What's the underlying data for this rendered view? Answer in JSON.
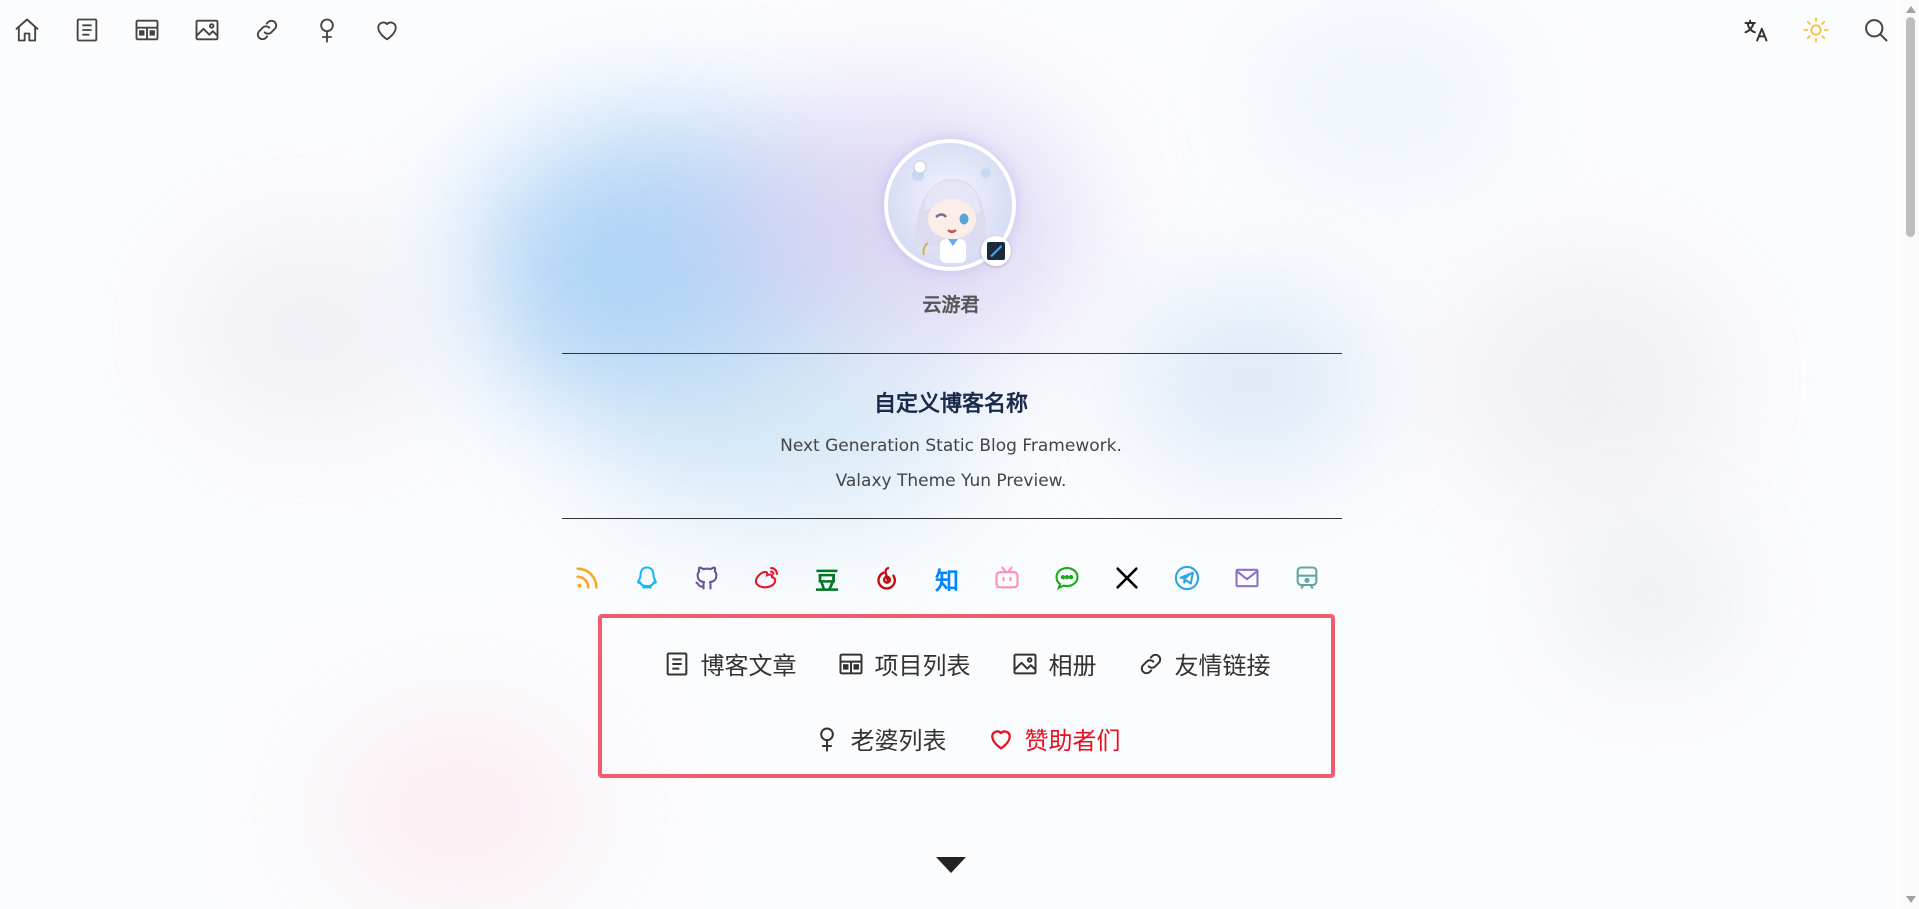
{
  "top_nav": {
    "left_icons": [
      "home-icon",
      "articles-icon",
      "projects-icon",
      "album-icon",
      "links-icon",
      "girls-icon",
      "sponsors-icon"
    ],
    "right_icons": [
      "translate-icon",
      "theme-toggle-icon",
      "search-icon"
    ]
  },
  "profile": {
    "author": "云游君"
  },
  "site": {
    "title": "自定义博客名称",
    "subtitle_line1": "Next Generation Static Blog Framework.",
    "subtitle_line2": "Valaxy Theme Yun Preview."
  },
  "social": [
    {
      "name": "rss",
      "color": "#f9a825"
    },
    {
      "name": "qq",
      "color": "#12b7f5"
    },
    {
      "name": "github",
      "color": "#6e5494"
    },
    {
      "name": "weibo",
      "color": "#e6162d"
    },
    {
      "name": "douban",
      "color": "#007722",
      "text": "豆"
    },
    {
      "name": "netease-music",
      "color": "#c20c0c"
    },
    {
      "name": "zhihu",
      "color": "#0084ff",
      "text": "知"
    },
    {
      "name": "bilibili",
      "color": "#ff8eb3"
    },
    {
      "name": "wechat",
      "color": "#1aad19"
    },
    {
      "name": "x",
      "color": "#000000"
    },
    {
      "name": "telegram",
      "color": "#2ca5e0"
    },
    {
      "name": "email",
      "color": "#8e71c1"
    },
    {
      "name": "travelling",
      "color": "#5fa8a0"
    }
  ],
  "menu": {
    "row1": [
      {
        "label": "博客文章",
        "icon": "articles-icon"
      },
      {
        "label": "项目列表",
        "icon": "projects-icon"
      },
      {
        "label": "相册",
        "icon": "album-icon"
      },
      {
        "label": "友情链接",
        "icon": "links-icon"
      }
    ],
    "row2": [
      {
        "label": "老婆列表",
        "icon": "girls-icon"
      },
      {
        "label": "赞助者们",
        "icon": "heart-icon",
        "color": "#e81020"
      }
    ]
  },
  "colors": {
    "highlight_border": "#f25a6e",
    "sun": "#f5c242"
  }
}
